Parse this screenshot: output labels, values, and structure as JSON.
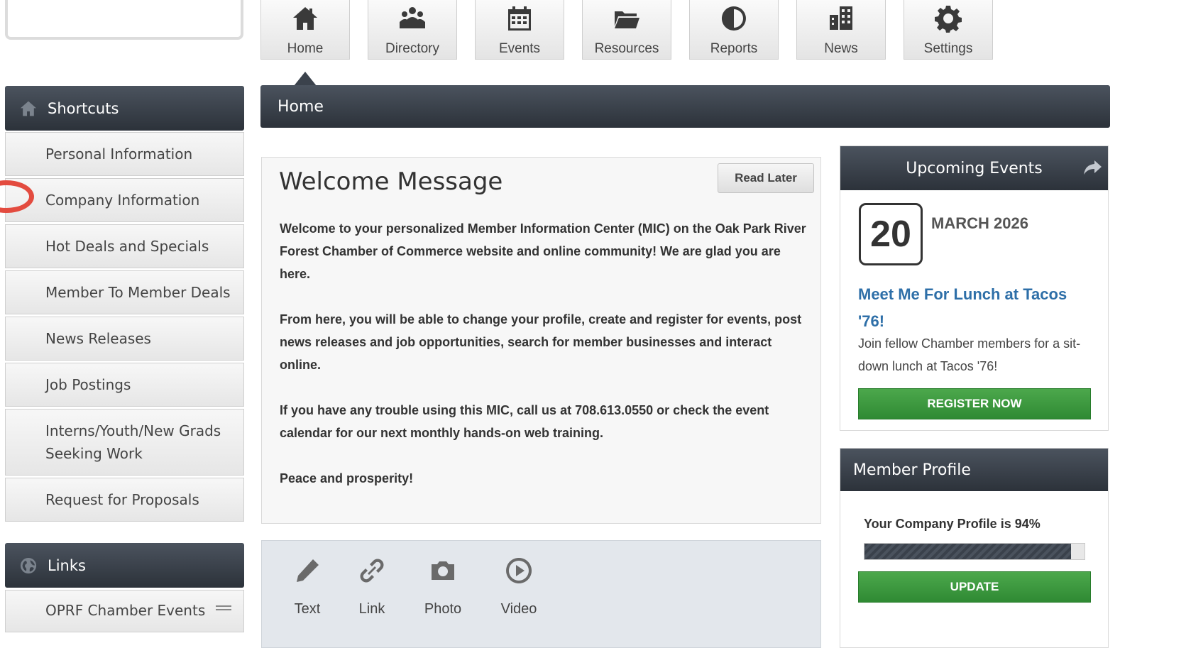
{
  "nav": {
    "items": [
      {
        "label": "Home",
        "icon": "home-icon"
      },
      {
        "label": "Directory",
        "icon": "directory-icon"
      },
      {
        "label": "Events",
        "icon": "calendar-icon"
      },
      {
        "label": "Resources",
        "icon": "folder-icon"
      },
      {
        "label": "Reports",
        "icon": "pie-chart-icon"
      },
      {
        "label": "News",
        "icon": "buildings-icon"
      },
      {
        "label": "Settings",
        "icon": "gear-icon"
      }
    ]
  },
  "breadcrumb": {
    "current": "Home"
  },
  "sidebar": {
    "shortcuts_title": "Shortcuts",
    "items": [
      {
        "label": "Personal Information"
      },
      {
        "label": "Company Information"
      },
      {
        "label": "Hot Deals and Specials"
      },
      {
        "label": "Member To Member Deals"
      },
      {
        "label": "News Releases"
      },
      {
        "label": "Job Postings"
      },
      {
        "label": "Interns/Youth/New Grads Seeking Work"
      },
      {
        "label": "Request for Proposals"
      }
    ],
    "links_title": "Links",
    "links_items": [
      {
        "label": "OPRF Chamber Events"
      }
    ]
  },
  "welcome": {
    "title": "Welcome Message",
    "read_later_label": "Read Later",
    "paragraphs": [
      "Welcome to your personalized Member Information Center (MIC) on the Oak Park River Forest Chamber of Commerce website and online community!  We are glad you are here.",
      "From here, you will be able to change your profile, create and register for events, post news releases and job opportunities, search for member businesses and interact online.",
      "If you have any trouble using this MIC, call us at 708.613.0550 or check the event calendar for our next monthly hands-on web training.",
      "Peace and prosperity!"
    ]
  },
  "post_tools": {
    "items": [
      {
        "label": "Text",
        "icon": "pencil-icon"
      },
      {
        "label": "Link",
        "icon": "link-icon"
      },
      {
        "label": "Photo",
        "icon": "camera-icon"
      },
      {
        "label": "Video",
        "icon": "play-icon"
      }
    ]
  },
  "events": {
    "title": "Upcoming Events",
    "day": "20",
    "month_year": "MARCH 2026",
    "event_title": "Meet Me For Lunch at Tacos '76!",
    "description": "Join fellow Chamber members for a sit-down lunch at Tacos '76!",
    "register_label": "REGISTER NOW"
  },
  "profile": {
    "title": "Member Profile",
    "completion_text": "Your Company Profile is 94%",
    "completion_percent": 94,
    "update_label": "UPDATE"
  },
  "colors": {
    "header_dark": "#2c323a",
    "link_blue": "#2e6fa8",
    "button_green": "#3a9a3d",
    "highlight_red": "#e34b3f"
  }
}
